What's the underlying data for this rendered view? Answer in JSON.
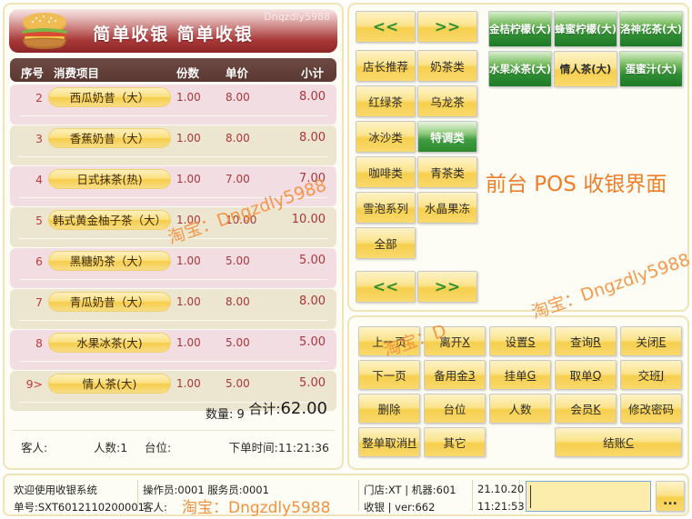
{
  "header": {
    "title": "简单收银  简单收银",
    "user": "Dnqzdly5988",
    "burger_icon": "hamburger-icon"
  },
  "order_table": {
    "columns": {
      "seq": "序号",
      "item": "消费项目",
      "qty": "份数",
      "price": "单价",
      "subtotal": "小计"
    },
    "rows": [
      {
        "seq": "2",
        "name": "西瓜奶昔（大）",
        "qty": "1.00",
        "price": "8.00",
        "subtotal": "8.00"
      },
      {
        "seq": "3",
        "name": "香蕉奶昔（大）",
        "qty": "1.00",
        "price": "8.00",
        "subtotal": "8.00"
      },
      {
        "seq": "4",
        "name": "日式抹茶(热)",
        "qty": "1.00",
        "price": "7.00",
        "subtotal": "7.00"
      },
      {
        "seq": "5",
        "name": "韩式黄金柚子茶（大）",
        "qty": "1.00",
        "price": "10.00",
        "subtotal": "10.00"
      },
      {
        "seq": "6",
        "name": "黑糖奶茶（大）",
        "qty": "1.00",
        "price": "5.00",
        "subtotal": "5.00"
      },
      {
        "seq": "7",
        "name": "青瓜奶昔（大）",
        "qty": "1.00",
        "price": "8.00",
        "subtotal": "8.00"
      },
      {
        "seq": "8",
        "name": "水果冰茶(大)",
        "qty": "1.00",
        "price": "5.00",
        "subtotal": "5.00"
      },
      {
        "seq": "9>",
        "name": "情人茶(大)",
        "qty": "1.00",
        "price": "5.00",
        "subtotal": "5.00"
      }
    ]
  },
  "totals": {
    "qty_label": "数量: 9",
    "sum_label": "合计:",
    "sum_value": "62.00"
  },
  "guest_bar": {
    "guest": "客人:",
    "people": "人数:1",
    "table": "台位:",
    "order_time": "下单时间:11:21:36"
  },
  "categories": {
    "nav_prev": "<<",
    "nav_next": ">>",
    "items": [
      {
        "label": "店长推荐",
        "selected": false
      },
      {
        "label": "奶茶类",
        "selected": false
      },
      {
        "label": "红绿茶",
        "selected": false
      },
      {
        "label": "乌龙茶",
        "selected": false
      },
      {
        "label": "冰沙类",
        "selected": false
      },
      {
        "label": "特调类",
        "selected": true
      },
      {
        "label": "咖啡类",
        "selected": false
      },
      {
        "label": "青茶类",
        "selected": false
      },
      {
        "label": "雪泡系列",
        "selected": false
      },
      {
        "label": "水晶果冻",
        "selected": false
      },
      {
        "label": "全部",
        "selected": false
      }
    ]
  },
  "products": [
    {
      "label": "金桔柠檬(大)",
      "selected": false
    },
    {
      "label": "蜂蜜柠檬(大)",
      "selected": false
    },
    {
      "label": "洛神花茶(大)",
      "selected": false
    },
    {
      "label": "水果冰茶(大)",
      "selected": false
    },
    {
      "label": "情人茶(大)",
      "selected": true
    },
    {
      "label": "蛋蜜汁(大)",
      "selected": false
    }
  ],
  "pos_overlay": "前台 POS 收银界面",
  "function_keys": [
    [
      {
        "text": "上一页",
        "hotkey": ""
      },
      {
        "text": "离开 ",
        "hotkey": "X"
      },
      {
        "text": "设置 ",
        "hotkey": "S"
      },
      {
        "text": "查询 ",
        "hotkey": "R"
      },
      {
        "text": "关闭 ",
        "hotkey": "E"
      }
    ],
    [
      {
        "text": "下一页",
        "hotkey": ""
      },
      {
        "text": "备用金 ",
        "hotkey": "3"
      },
      {
        "text": "挂单 ",
        "hotkey": "G"
      },
      {
        "text": "取单 ",
        "hotkey": "Q"
      },
      {
        "text": "交班 ",
        "hotkey": "J"
      }
    ],
    [
      {
        "text": "删除",
        "hotkey": ""
      },
      {
        "text": "台位",
        "hotkey": ""
      },
      {
        "text": "人数",
        "hotkey": ""
      },
      {
        "text": "会员 ",
        "hotkey": "K"
      },
      {
        "text": "修改密码",
        "hotkey": ""
      }
    ],
    [
      {
        "text": "整单取消 ",
        "hotkey": "H"
      },
      {
        "text": "其它",
        "hotkey": ""
      },
      {
        "text": "",
        "hotkey": "",
        "blank": true
      },
      {
        "text": "结账 ",
        "hotkey": "C",
        "wide": true
      }
    ]
  ],
  "status_bar": {
    "welcome": "欢迎使用收银系统",
    "order_no": "单号:SXT6012110200001",
    "operator": "操作员:0001  服务员:0001",
    "guest": "客人:",
    "shop": "门店:XT | 机器:601",
    "cashier": "收银 | ver:662",
    "date": "21.10.20",
    "time": "11:21:53",
    "input_value": "",
    "dots_button": "..."
  },
  "watermarks": {
    "mark1": "淘宝：Dngzdly5988",
    "mark2": "淘宝：Dngzdly5988",
    "mark3": "淘宝：D",
    "status_mark": "淘宝：Dngzdly5988"
  },
  "colors": {
    "title_red": "#a83838",
    "header_brown": "#5a3832",
    "row_pink": "#f2dde3",
    "row_cream": "#ece5cf",
    "button_yellow": "#f6cf4d",
    "product_green": "#2f8d33",
    "panel_border": "#f0e3b8",
    "watermark_orange": "#f4913e",
    "amount_red": "#a8373a"
  }
}
